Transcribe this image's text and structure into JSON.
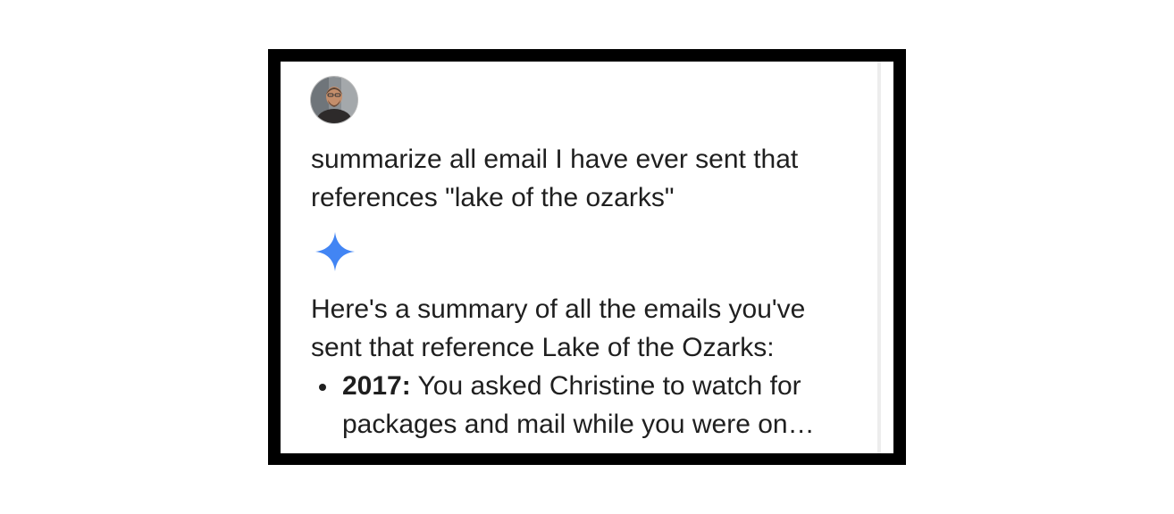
{
  "conversation": {
    "user_avatar_icon": "user-avatar-photo",
    "user_prompt": "summarize all email I have ever sent that references \"lake of the ozarks\"",
    "assistant_icon": "gemini-sparkle-icon",
    "assistant_color": "#4285f4",
    "response": {
      "intro": "Here's a summary of all the emails you've sent that reference Lake of the Ozarks:",
      "items": [
        {
          "year": "2017:",
          "text": " You asked Christine to watch for packages and mail while you were on…"
        }
      ]
    }
  },
  "colors": {
    "frame": "#000000",
    "text": "#1f1f1f",
    "background": "#ffffff"
  }
}
